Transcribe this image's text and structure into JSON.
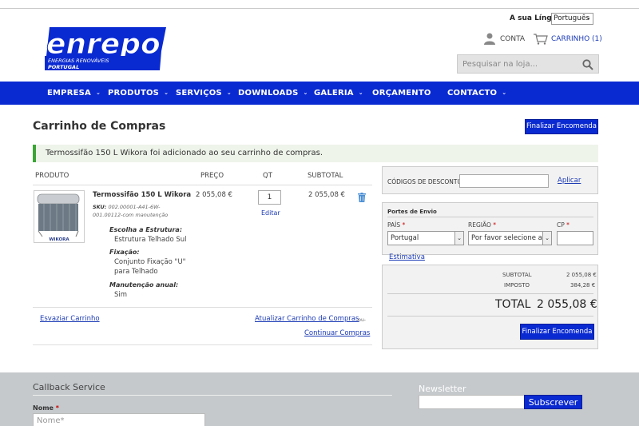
{
  "header": {
    "language_label": "A sua Língua:",
    "language_value": "Português",
    "logo": {
      "main": "enrepo",
      "line1": "ENERGIAS RENOVÁVEIS",
      "line2": "PORTUGAL"
    },
    "account_label": "CONTA",
    "cart_label": "CARRINHO (1)",
    "search_placeholder": "Pesquisar na loja..."
  },
  "nav": {
    "items": [
      {
        "label": "EMPRESA",
        "caret": "⌄"
      },
      {
        "label": "PRODUTOS",
        "caret": "⌄"
      },
      {
        "label": "SERVIÇOS",
        "caret": "⌄"
      },
      {
        "label": "DOWNLOADS",
        "caret": "⌄"
      },
      {
        "label": "GALERIA",
        "caret": "⌄"
      },
      {
        "label": "ORÇAMENTO",
        "caret": ""
      },
      {
        "label": "CONTACTO",
        "caret": "⌄"
      }
    ]
  },
  "page": {
    "title": "Carrinho de Compras",
    "checkout_label": "Finalizar Encomenda",
    "notice": "Termossifão 150 L Wikora foi adicionado ao seu carrinho de compras."
  },
  "cart": {
    "headers": {
      "product": "PRODUTO",
      "price": "PREÇO",
      "qty": "QT",
      "subtotal": "SUBTOTAL"
    },
    "item": {
      "name": "Termossifão 150 L Wikora",
      "sku_label": "SKU:",
      "sku": "002.00001-A41-6W-001.00112-com manutenção",
      "image_brand": "WIKORA",
      "price": "2 055,08 €",
      "qty": "1",
      "edit_label": "Editar",
      "subtotal": "2 055,08 €",
      "options": [
        {
          "label": "Escolha a Estrutura:",
          "value": "Estrutura Telhado Sul"
        },
        {
          "label": "Fixação:",
          "value": "Conjunto Fixação \"U\" para Telhado"
        },
        {
          "label": "Manutenção anual:",
          "value": "Sim"
        }
      ]
    },
    "empty_label": "Esvaziar Carrinho",
    "update_label": "Atualizar Carrinho de Compras",
    "or_label": "-ou-",
    "continue_label": "Continuar Compras"
  },
  "discount": {
    "label": "CÓDIGOS DE DESCONTO",
    "apply_label": "Aplicar"
  },
  "shipping": {
    "title": "Portes de Envio",
    "country_label": "PAÍS",
    "country_value": "Portugal",
    "region_label": "REGIÃO",
    "region_value": "Por favor selecione a região",
    "zip_label": "CP",
    "required_mark": "*",
    "estimate_label": "Estimativa"
  },
  "totals": {
    "subtotal_label": "SUBTOTAL",
    "subtotal_value": "2 055,08 €",
    "tax_label": "IMPOSTO",
    "tax_value": "384,28 €",
    "total_label": "TOTAL",
    "total_value": "2 055,08 €",
    "checkout_label": "Finalizar Encomenda"
  },
  "footer": {
    "callback_title": "Callback Service",
    "name_label": "Nome",
    "name_required": "*",
    "name_placeholder": "Nome*",
    "newsletter_title": "Newsletter",
    "subscribe_label": "Subscrever"
  },
  "colors": {
    "nav_blue": "#0a2ad1",
    "link_blue": "#1b3ab5",
    "notice_green": "#3aa535",
    "footer_gray": "#c5c9cc"
  }
}
